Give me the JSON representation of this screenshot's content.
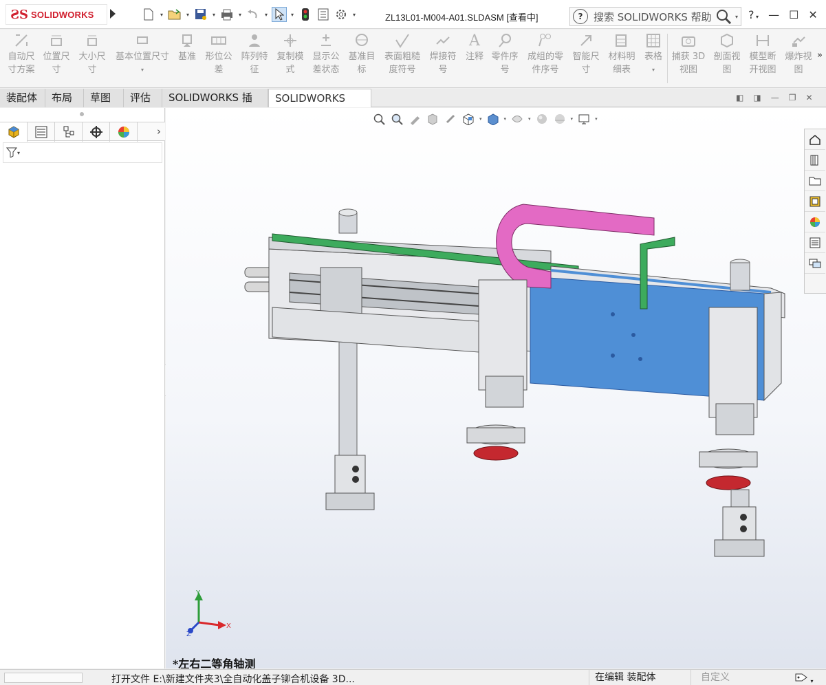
{
  "titlebar": {
    "brand_logo": "SOLIDWORKS",
    "document_title": "ZL13L01-M004-A01.SLDASM [查看中]",
    "search_placeholder": "搜索 SOLIDWORKS 帮助",
    "help_label": "?",
    "quick_access_icons": [
      "new-document-icon",
      "open-file-icon",
      "save-icon",
      "print-icon",
      "undo-icon",
      "select-arrow-icon",
      "rebuild-icon",
      "file-properties-icon",
      "options-gear-icon"
    ]
  },
  "ribbon": {
    "items": [
      {
        "label": "自动尺\n寸方案",
        "icon": "auto-dimension-icon"
      },
      {
        "label": "位置尺\n寸",
        "icon": "location-dimension-icon"
      },
      {
        "label": "大小尺\n寸",
        "icon": "size-dimension-icon"
      },
      {
        "label": "基本位置尺寸",
        "icon": "basic-location-dimension-icon"
      },
      {
        "label": "基准",
        "icon": "datum-icon"
      },
      {
        "label": "形位公\n差",
        "icon": "geometric-tolerance-icon"
      },
      {
        "label": "阵列特\n征",
        "icon": "pattern-feature-icon"
      },
      {
        "label": "复制模\n式",
        "icon": "copy-scheme-icon"
      },
      {
        "label": "显示公\n差状态",
        "icon": "tolerance-status-icon"
      },
      {
        "label": "基准目\n标",
        "icon": "datum-target-icon"
      },
      {
        "label": "表面粗糙\n度符号",
        "icon": "surface-finish-icon"
      },
      {
        "label": "焊接符\n号",
        "icon": "weld-symbol-icon"
      },
      {
        "label": "注释",
        "icon": "note-icon"
      },
      {
        "label": "零件序\n号",
        "icon": "balloon-icon"
      },
      {
        "label": "成组的零\n件序号",
        "icon": "stacked-balloon-icon"
      },
      {
        "label": "智能尺\n寸",
        "icon": "smart-dimension-icon"
      },
      {
        "label": "材料明\n细表",
        "icon": "bom-icon"
      },
      {
        "label": "表格",
        "icon": "table-icon"
      },
      {
        "label": "捕获 3D\n视图",
        "icon": "capture-3d-view-icon"
      },
      {
        "label": "剖面视\n图",
        "icon": "section-view-icon"
      },
      {
        "label": "模型断\n开视图",
        "icon": "model-break-view-icon"
      },
      {
        "label": "爆炸视\n图",
        "icon": "exploded-view-icon"
      }
    ],
    "more": "»"
  },
  "tabs": [
    "装配体",
    "布局",
    "草图",
    "评估",
    "SOLIDWORKS 插件",
    "SOLIDWORKS MBD"
  ],
  "active_tab": "SOLIDWORKS MBD",
  "left_panel": {
    "tabs": [
      "feature-manager-icon",
      "property-manager-icon",
      "configuration-manager-icon",
      "dimxpert-manager-icon",
      "display-manager-icon"
    ],
    "more": "›",
    "filter_icon": "filter-icon"
  },
  "viewport": {
    "view_label": "*左右二等角轴测",
    "axes": {
      "x": "X",
      "y": "Y",
      "z": "Z"
    },
    "colors": {
      "pink": "#e36ac4",
      "green": "#3dab5d",
      "blue": "#4f8fd6",
      "red": "#c4282f"
    }
  },
  "taskpane": [
    "home-icon",
    "design-library-icon",
    "file-explorer-icon",
    "view-palette-icon",
    "appearances-icon",
    "custom-properties-icon",
    "forum-icon"
  ],
  "status": {
    "file_text": "打开文件  E:\\新建文件夹3\\全自动化盖子铆合机设备 3D...",
    "mode": "在编辑 装配体",
    "custom": "自定义"
  }
}
